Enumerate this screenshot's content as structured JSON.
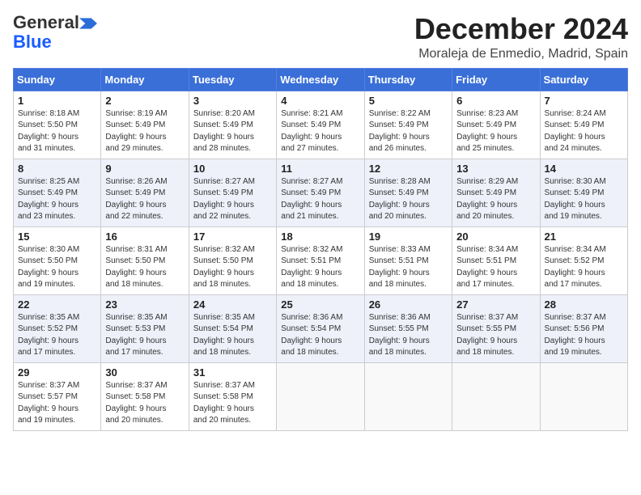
{
  "header": {
    "logo_line1": "General",
    "logo_line2": "Blue",
    "month_title": "December 2024",
    "location": "Moraleja de Enmedio, Madrid, Spain"
  },
  "weekdays": [
    "Sunday",
    "Monday",
    "Tuesday",
    "Wednesday",
    "Thursday",
    "Friday",
    "Saturday"
  ],
  "weeks": [
    [
      {
        "day": "1",
        "lines": [
          "Sunrise: 8:18 AM",
          "Sunset: 5:50 PM",
          "Daylight: 9 hours",
          "and 31 minutes."
        ]
      },
      {
        "day": "2",
        "lines": [
          "Sunrise: 8:19 AM",
          "Sunset: 5:49 PM",
          "Daylight: 9 hours",
          "and 29 minutes."
        ]
      },
      {
        "day": "3",
        "lines": [
          "Sunrise: 8:20 AM",
          "Sunset: 5:49 PM",
          "Daylight: 9 hours",
          "and 28 minutes."
        ]
      },
      {
        "day": "4",
        "lines": [
          "Sunrise: 8:21 AM",
          "Sunset: 5:49 PM",
          "Daylight: 9 hours",
          "and 27 minutes."
        ]
      },
      {
        "day": "5",
        "lines": [
          "Sunrise: 8:22 AM",
          "Sunset: 5:49 PM",
          "Daylight: 9 hours",
          "and 26 minutes."
        ]
      },
      {
        "day": "6",
        "lines": [
          "Sunrise: 8:23 AM",
          "Sunset: 5:49 PM",
          "Daylight: 9 hours",
          "and 25 minutes."
        ]
      },
      {
        "day": "7",
        "lines": [
          "Sunrise: 8:24 AM",
          "Sunset: 5:49 PM",
          "Daylight: 9 hours",
          "and 24 minutes."
        ]
      }
    ],
    [
      {
        "day": "8",
        "lines": [
          "Sunrise: 8:25 AM",
          "Sunset: 5:49 PM",
          "Daylight: 9 hours",
          "and 23 minutes."
        ]
      },
      {
        "day": "9",
        "lines": [
          "Sunrise: 8:26 AM",
          "Sunset: 5:49 PM",
          "Daylight: 9 hours",
          "and 22 minutes."
        ]
      },
      {
        "day": "10",
        "lines": [
          "Sunrise: 8:27 AM",
          "Sunset: 5:49 PM",
          "Daylight: 9 hours",
          "and 22 minutes."
        ]
      },
      {
        "day": "11",
        "lines": [
          "Sunrise: 8:27 AM",
          "Sunset: 5:49 PM",
          "Daylight: 9 hours",
          "and 21 minutes."
        ]
      },
      {
        "day": "12",
        "lines": [
          "Sunrise: 8:28 AM",
          "Sunset: 5:49 PM",
          "Daylight: 9 hours",
          "and 20 minutes."
        ]
      },
      {
        "day": "13",
        "lines": [
          "Sunrise: 8:29 AM",
          "Sunset: 5:49 PM",
          "Daylight: 9 hours",
          "and 20 minutes."
        ]
      },
      {
        "day": "14",
        "lines": [
          "Sunrise: 8:30 AM",
          "Sunset: 5:49 PM",
          "Daylight: 9 hours",
          "and 19 minutes."
        ]
      }
    ],
    [
      {
        "day": "15",
        "lines": [
          "Sunrise: 8:30 AM",
          "Sunset: 5:50 PM",
          "Daylight: 9 hours",
          "and 19 minutes."
        ]
      },
      {
        "day": "16",
        "lines": [
          "Sunrise: 8:31 AM",
          "Sunset: 5:50 PM",
          "Daylight: 9 hours",
          "and 18 minutes."
        ]
      },
      {
        "day": "17",
        "lines": [
          "Sunrise: 8:32 AM",
          "Sunset: 5:50 PM",
          "Daylight: 9 hours",
          "and 18 minutes."
        ]
      },
      {
        "day": "18",
        "lines": [
          "Sunrise: 8:32 AM",
          "Sunset: 5:51 PM",
          "Daylight: 9 hours",
          "and 18 minutes."
        ]
      },
      {
        "day": "19",
        "lines": [
          "Sunrise: 8:33 AM",
          "Sunset: 5:51 PM",
          "Daylight: 9 hours",
          "and 18 minutes."
        ]
      },
      {
        "day": "20",
        "lines": [
          "Sunrise: 8:34 AM",
          "Sunset: 5:51 PM",
          "Daylight: 9 hours",
          "and 17 minutes."
        ]
      },
      {
        "day": "21",
        "lines": [
          "Sunrise: 8:34 AM",
          "Sunset: 5:52 PM",
          "Daylight: 9 hours",
          "and 17 minutes."
        ]
      }
    ],
    [
      {
        "day": "22",
        "lines": [
          "Sunrise: 8:35 AM",
          "Sunset: 5:52 PM",
          "Daylight: 9 hours",
          "and 17 minutes."
        ]
      },
      {
        "day": "23",
        "lines": [
          "Sunrise: 8:35 AM",
          "Sunset: 5:53 PM",
          "Daylight: 9 hours",
          "and 17 minutes."
        ]
      },
      {
        "day": "24",
        "lines": [
          "Sunrise: 8:35 AM",
          "Sunset: 5:54 PM",
          "Daylight: 9 hours",
          "and 18 minutes."
        ]
      },
      {
        "day": "25",
        "lines": [
          "Sunrise: 8:36 AM",
          "Sunset: 5:54 PM",
          "Daylight: 9 hours",
          "and 18 minutes."
        ]
      },
      {
        "day": "26",
        "lines": [
          "Sunrise: 8:36 AM",
          "Sunset: 5:55 PM",
          "Daylight: 9 hours",
          "and 18 minutes."
        ]
      },
      {
        "day": "27",
        "lines": [
          "Sunrise: 8:37 AM",
          "Sunset: 5:55 PM",
          "Daylight: 9 hours",
          "and 18 minutes."
        ]
      },
      {
        "day": "28",
        "lines": [
          "Sunrise: 8:37 AM",
          "Sunset: 5:56 PM",
          "Daylight: 9 hours",
          "and 19 minutes."
        ]
      }
    ],
    [
      {
        "day": "29",
        "lines": [
          "Sunrise: 8:37 AM",
          "Sunset: 5:57 PM",
          "Daylight: 9 hours",
          "and 19 minutes."
        ]
      },
      {
        "day": "30",
        "lines": [
          "Sunrise: 8:37 AM",
          "Sunset: 5:58 PM",
          "Daylight: 9 hours",
          "and 20 minutes."
        ]
      },
      {
        "day": "31",
        "lines": [
          "Sunrise: 8:37 AM",
          "Sunset: 5:58 PM",
          "Daylight: 9 hours",
          "and 20 minutes."
        ]
      },
      {
        "day": "",
        "lines": []
      },
      {
        "day": "",
        "lines": []
      },
      {
        "day": "",
        "lines": []
      },
      {
        "day": "",
        "lines": []
      }
    ]
  ]
}
